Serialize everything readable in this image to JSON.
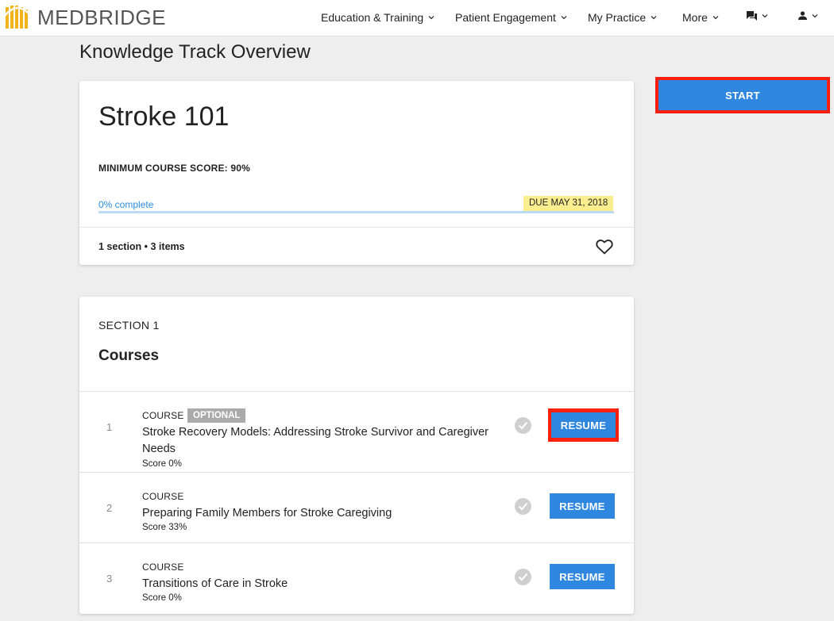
{
  "nav": {
    "logo_text": "MEDBRIDGE",
    "items": [
      {
        "label": "Education & Training"
      },
      {
        "label": "Patient Engagement"
      },
      {
        "label": "My Practice"
      },
      {
        "label": "More"
      }
    ]
  },
  "page": {
    "title": "Knowledge Track Overview"
  },
  "overview": {
    "course_title": "Stroke 101",
    "minimum_score": "MINIMUM COURSE SCORE: 90%",
    "progress_label": "0% complete",
    "progress_fraction": 0,
    "due": "DUE MAY 31, 2018",
    "meta": "1 section • 3 items"
  },
  "start_label": "START",
  "section": {
    "label": "SECTION 1",
    "heading": "Courses",
    "items": [
      {
        "num": "1",
        "type": "COURSE",
        "badge": "OPTIONAL",
        "title": "Stroke Recovery Models: Addressing Stroke Survivor and Caregiver Needs",
        "score": "Score 0%",
        "action": "RESUME"
      },
      {
        "num": "2",
        "type": "COURSE",
        "title": "Preparing Family Members for Stroke Caregiving",
        "score": "Score 33%",
        "action": "RESUME"
      },
      {
        "num": "3",
        "type": "COURSE",
        "title": "Transitions of Care in Stroke",
        "score": "Score 0%",
        "action": "RESUME"
      }
    ]
  },
  "colors": {
    "accent": "#2f87e0",
    "highlight": "#ff1f0f",
    "due_badge": "#fbee8f"
  }
}
